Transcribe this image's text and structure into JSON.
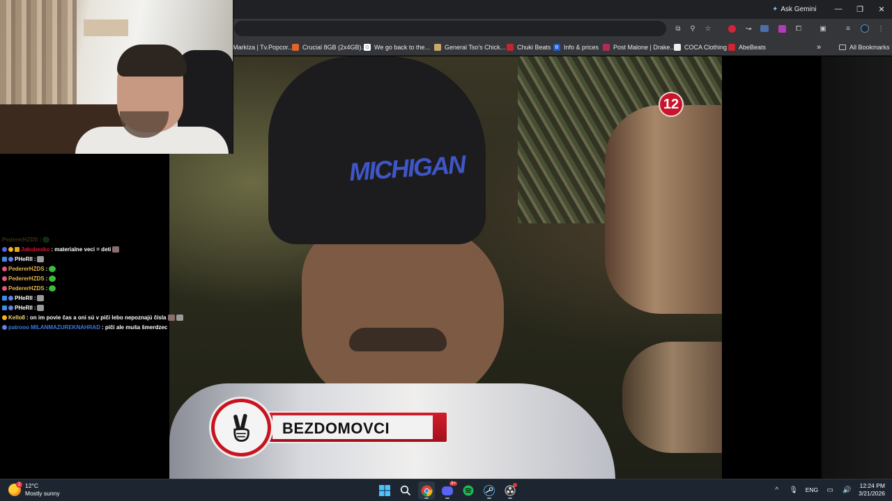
{
  "browser": {
    "ask_gemini": "Ask Gemini",
    "bookmarks": [
      {
        "label": "Markíza | Tv.Popcor...",
        "color": "#1d1d1d"
      },
      {
        "label": "Crucial 8GB (2x4GB)...",
        "color": "#e0652a"
      },
      {
        "label": "We go back to the...",
        "color": "#ffffff"
      },
      {
        "label": "General Tso's Chick...",
        "color": "#c9a86a"
      },
      {
        "label": "Chuki Beats",
        "color": "#c0262c"
      },
      {
        "label": "Info & prices",
        "color": "#1f5fc8"
      },
      {
        "label": "Post Malone | Drake...",
        "color": "#b22b55"
      },
      {
        "label": "COCA Clothing",
        "color": "#eeeeee"
      },
      {
        "label": "AbeBeats",
        "color": "#d12430"
      }
    ],
    "more_label": "»",
    "all_bookmarks": "All Bookmarks",
    "window_controls": [
      "—",
      "❐",
      "✕"
    ]
  },
  "chat": {
    "messages": [
      {
        "user": "PedererHZDS",
        "text": ":",
        "user_color": "#5a2323",
        "faded": true
      },
      {
        "user": "Jakubesko",
        "text": ": materialne veci = deti",
        "user_color": "#e0142f"
      },
      {
        "user": "PHeRII",
        "text": ":",
        "user_color": "#ffffff"
      },
      {
        "user": "PedererHZDS",
        "text": ":",
        "user_color": "#e8b84a"
      },
      {
        "user": "PedererHZDS",
        "text": ":",
        "user_color": "#e8b84a"
      },
      {
        "user": "PedererHZDS",
        "text": ":",
        "user_color": "#e8b84a"
      },
      {
        "user": "PHeRII",
        "text": ":",
        "user_color": "#ffffff"
      },
      {
        "user": "PHeRII",
        "text": ":",
        "user_color": "#ffffff"
      },
      {
        "user": "Kello8",
        "text": ": on im povie čas a oni sú v piči lebo nepoznajú čísla",
        "user_color": "#f2d47a"
      },
      {
        "user": "patrooo MILANMAZUREKNAHRAD",
        "text": ": piči ale muša šmerdzec",
        "user_color": "#3a78e0"
      }
    ]
  },
  "video": {
    "channel_number": "12",
    "lower_third_label": "BEZDOMOVCI",
    "beanie_text": "MICHIGAN"
  },
  "taskbar": {
    "weather": {
      "temp": "12°C",
      "condition": "Mostly sunny",
      "badge": "2"
    },
    "apps": [
      "windows-start",
      "search",
      "chrome",
      "discord",
      "spotify",
      "steam",
      "obs"
    ],
    "discord_badge": "9+",
    "language": "ENG",
    "time": "12:24 PM",
    "date": "3/21/2026"
  }
}
